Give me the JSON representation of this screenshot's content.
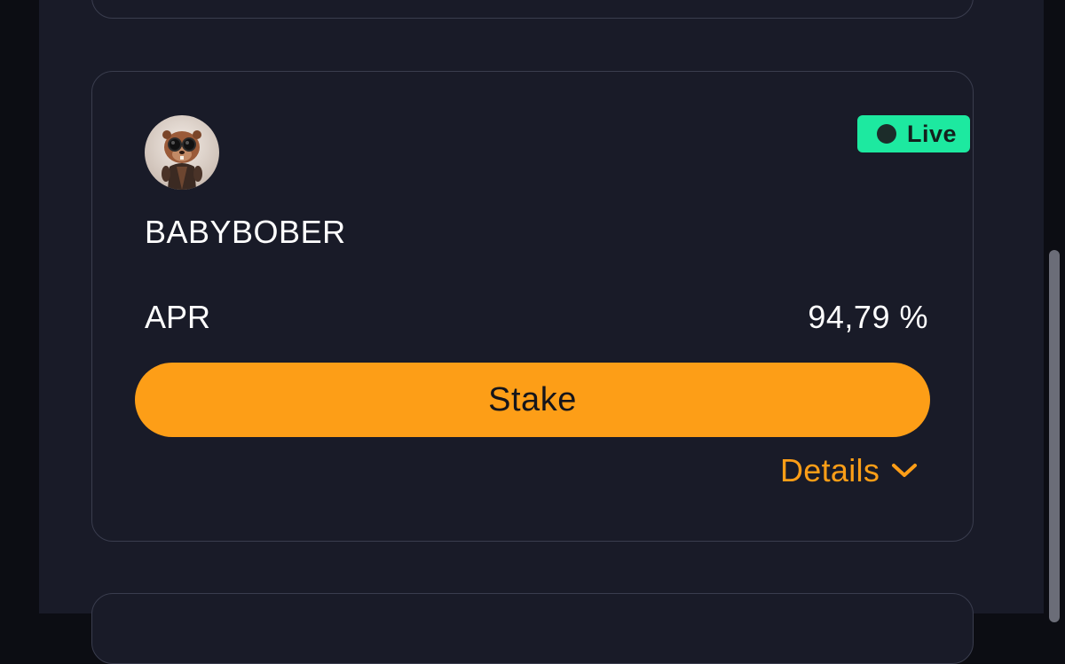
{
  "pool": {
    "status": "Live",
    "token_name": "BABYBOBER",
    "apr_label": "APR",
    "apr_value": "94,79 %",
    "stake_label": "Stake",
    "details_label": "Details",
    "avatar_icon": "beaver-with-sunglasses-avatar",
    "details_icon": "chevron-down-icon"
  },
  "colors": {
    "accent": "#fd9e17",
    "live": "#1de9a0",
    "card_bg": "#191b28",
    "page_bg": "#0c0d13"
  }
}
